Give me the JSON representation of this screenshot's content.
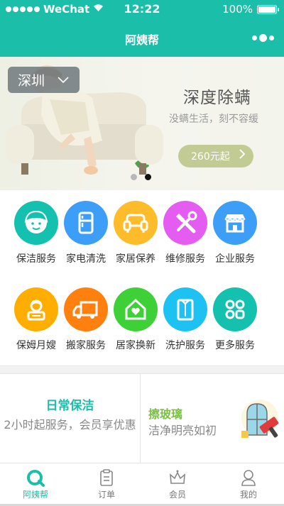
{
  "status_bar": {
    "carrier": "WeChat",
    "time": "12:22",
    "battery": "100%",
    "battery_level": 1.0
  },
  "nav": {
    "title": "阿姨帮"
  },
  "banner": {
    "city": "深圳",
    "promo_title": "深度除螨",
    "promo_subtitle": "没螨生活，刻不容缓",
    "price_button": "260元起",
    "page_count": 2,
    "active_page": 2
  },
  "services": [
    {
      "label": "保洁服务",
      "icon": "cleaner-face-icon",
      "color": "#14c1ae"
    },
    {
      "label": "家电清洗",
      "icon": "fridge-icon",
      "color": "#3d9ef8"
    },
    {
      "label": "家居保养",
      "icon": "sofa-icon",
      "color": "#ffbc2a"
    },
    {
      "label": "维修服务",
      "icon": "tools-icon",
      "color": "#e45cf0"
    },
    {
      "label": "企业服务",
      "icon": "storefront-icon",
      "color": "#3d9ef8"
    },
    {
      "label": "保姆月嫂",
      "icon": "nanny-icon",
      "color": "#ffae00"
    },
    {
      "label": "搬家服务",
      "icon": "truck-icon",
      "color": "#ff7f0f"
    },
    {
      "label": "居家换新",
      "icon": "house-heart-icon",
      "color": "#3dd137"
    },
    {
      "label": "洗护服务",
      "icon": "shirt-icon",
      "color": "#1ec2f2"
    },
    {
      "label": "更多服务",
      "icon": "grid-more-icon",
      "color": "#14c1ae"
    }
  ],
  "features": {
    "left": {
      "title": "日常保洁",
      "desc": "2小时起服务，会员享优惠"
    },
    "right": {
      "title": "擦玻璃",
      "desc": "洁净明亮如初"
    }
  },
  "tabs": [
    {
      "label": "阿姨帮",
      "icon": "home-logo-icon",
      "active": true
    },
    {
      "label": "订单",
      "icon": "clipboard-icon",
      "active": false
    },
    {
      "label": "会员",
      "icon": "crown-icon",
      "active": false
    },
    {
      "label": "我的",
      "icon": "user-icon",
      "active": false
    }
  ],
  "colors": {
    "brand": "#1bbfa9",
    "promo_button": "#c3cb94",
    "feature_left": "#1bbfa9",
    "feature_right": "#7ac143"
  }
}
